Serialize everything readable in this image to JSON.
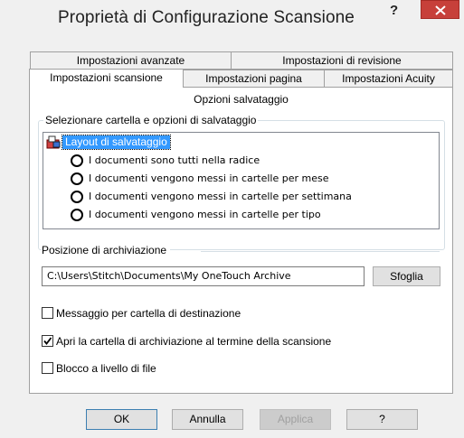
{
  "window": {
    "title": "Proprietà di Configurazione Scansione",
    "help_glyph": "?",
    "close_glyph": "×"
  },
  "tabs": {
    "back": [
      {
        "label": "Impostazioni avanzate"
      },
      {
        "label": "Impostazioni di revisione"
      }
    ],
    "front": [
      {
        "label": "Impostazioni scansione",
        "active": true
      },
      {
        "label": "Impostazioni pagina",
        "active": false
      },
      {
        "label": "Impostazioni Acuity",
        "active": false
      }
    ]
  },
  "panel": {
    "title": "Opzioni salvataggio",
    "group_label": "Selezionare cartella e opzioni di salvataggio",
    "tree": {
      "root_label": "Layout di salvataggio",
      "options": [
        {
          "label": "I documenti sono tutti nella radice"
        },
        {
          "label": "I documenti vengono messi in cartelle per mese"
        },
        {
          "label": "I documenti vengono messi in cartelle per settimana"
        },
        {
          "label": "I documenti vengono messi in cartelle per tipo"
        }
      ]
    },
    "archive_label": "Posizione di archiviazione",
    "archive_path": "C:\\Users\\Stitch\\Documents\\My OneTouch Archive",
    "browse_label": "Sfoglia",
    "checkboxes": [
      {
        "label": "Messaggio per cartella di destinazione",
        "checked": false
      },
      {
        "label": "Apri la cartella di archiviazione al termine della scansione",
        "checked": true
      },
      {
        "label": "Blocco a livello di file",
        "checked": false
      }
    ]
  },
  "buttons": {
    "ok": "OK",
    "cancel": "Annulla",
    "apply": "Applica",
    "help": "?"
  },
  "colors": {
    "close_button": "#c7403a",
    "selection": "#3399ff",
    "accent_border": "#3c7fb1"
  }
}
